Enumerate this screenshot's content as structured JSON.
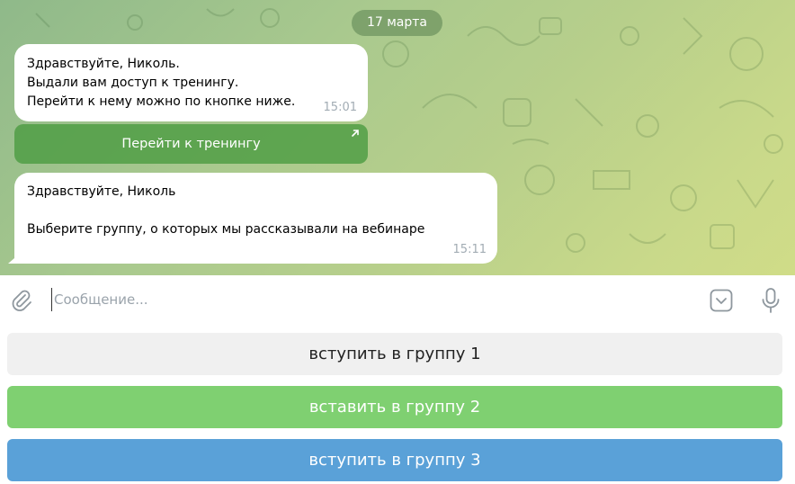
{
  "chat": {
    "date": "17 марта",
    "messages": [
      {
        "lines": [
          "Здравствуйте, Николь.",
          "Выдали вам доступ к тренингу.",
          "Перейти к нему можно по кнопке ниже."
        ],
        "time": "15:01",
        "inline_button": "Перейти к тренингу"
      },
      {
        "lines": [
          "Здравствуйте, Николь",
          "",
          "Выберите группу, о которых мы рассказывали на вебинаре"
        ],
        "time": "15:11"
      }
    ]
  },
  "composer": {
    "placeholder": "Сообщение...",
    "value": ""
  },
  "keyboard": {
    "buttons": [
      "вступить в группу 1",
      "вставить в группу 2",
      "вступить в группу 3"
    ]
  },
  "icons": {
    "attach": "paperclip-icon",
    "keyboard": "keyboard-toggle-icon",
    "mic": "microphone-icon",
    "inline_link": "arrow-up-right-icon"
  },
  "colors": {
    "button_1": "#f0f0f0",
    "button_2": "#7fd071",
    "button_3": "#5aa1d8",
    "inline_button": "#4b9b41"
  }
}
